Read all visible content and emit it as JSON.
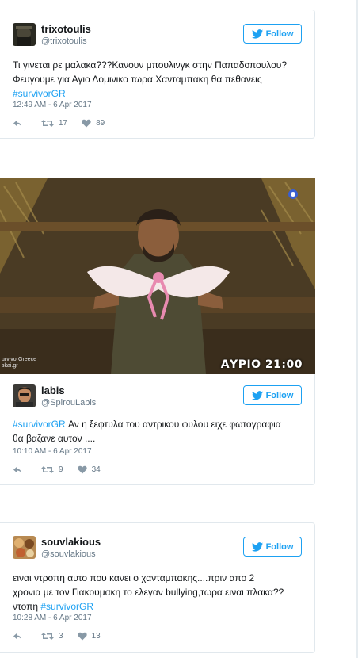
{
  "colors": {
    "accent": "#1da1f2",
    "muted": "#657786"
  },
  "tweets": [
    {
      "display_name": "trixotoulis",
      "handle": "@trixotoulis",
      "follow_label": "Follow",
      "text_line1": "Τι γινεται ρε μαλακα???Κανουν μπουλινγκ στην Παπαδοπουλου?",
      "text_line2": "Φευγουμε για Αγιο Δομινικο τωρα.Χανταμπακη θα πεθανεις",
      "hashtag": "#survivorGR",
      "timestamp": "12:49 AM - 6 Apr 2017",
      "retweets": "17",
      "likes": "89"
    },
    {
      "display_name": "labis",
      "handle": "@SpirouLabis",
      "follow_label": "Follow",
      "hashtag": "#survivorGR",
      "text_line1": " Αν η ξεφτυλα του αντρικου φυλου ειχε φωτογραφια",
      "text_line2": "θα βαζανε αυτον ....",
      "timestamp": "10:10 AM - 6 Apr 2017",
      "retweets": "9",
      "likes": "34",
      "media_caption": "ΑΥΡΙΟ 21:00",
      "media_watermark_1": "urvivorGreece",
      "media_watermark_2": "skai.gr"
    },
    {
      "display_name": "souvlakious",
      "handle": "@souvlakious",
      "follow_label": "Follow",
      "text_line1": "ειναι ντροπη αυτο που κανει ο χανταμπακης....πριν απο 2",
      "text_line2": "χρονια με τον Γιακουμακη το ελεγαν bullying,τωρα ειναι πλακα??",
      "text_line3": "ντοπη ",
      "hashtag": "#survivorGR",
      "timestamp": "10:28 AM - 6 Apr 2017",
      "retweets": "3",
      "likes": "13"
    }
  ]
}
